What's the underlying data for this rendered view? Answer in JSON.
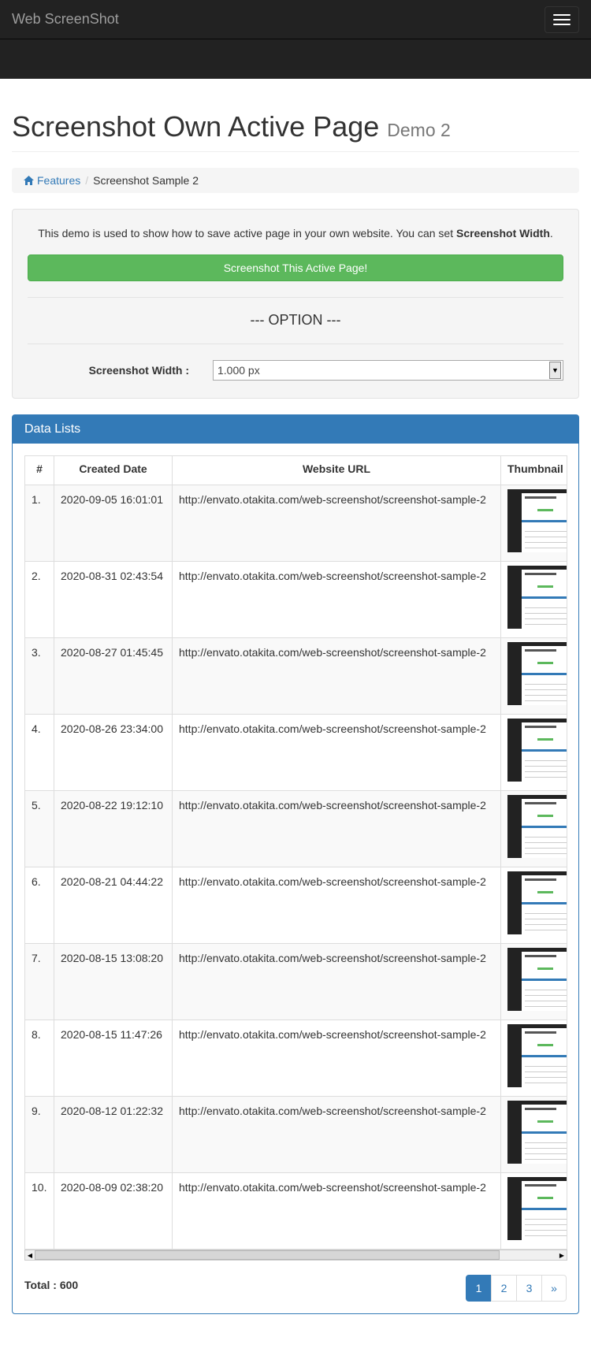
{
  "navbar": {
    "brand": "Web ScreenShot",
    "toggle_icon": "hamburger-menu-icon"
  },
  "header": {
    "title": "Screenshot Own Active Page",
    "subtitle": "Demo 2"
  },
  "breadcrumb": {
    "home_icon": "home-icon",
    "home_label": "Features",
    "current": "Screenshot Sample 2"
  },
  "intro": {
    "text": "This demo is used to show how to save active page in your own website. You can set",
    "bold": "Screenshot Width",
    "end": "."
  },
  "actions": {
    "screenshot_button": "Screenshot This Active Page!"
  },
  "options": {
    "title": "--- OPTION ---",
    "width_label": "Screenshot Width :",
    "width_value": "1.000 px"
  },
  "panel": {
    "title": "Data Lists",
    "columns": [
      "#",
      "Created Date",
      "Website URL",
      "Thumbnail"
    ],
    "rows": [
      {
        "num": "1.",
        "date": "2020-09-05 16:01:01",
        "url": "http://envato.otakita.com/web-screenshot/screenshot-sample-2"
      },
      {
        "num": "2.",
        "date": "2020-08-31 02:43:54",
        "url": "http://envato.otakita.com/web-screenshot/screenshot-sample-2"
      },
      {
        "num": "3.",
        "date": "2020-08-27 01:45:45",
        "url": "http://envato.otakita.com/web-screenshot/screenshot-sample-2"
      },
      {
        "num": "4.",
        "date": "2020-08-26 23:34:00",
        "url": "http://envato.otakita.com/web-screenshot/screenshot-sample-2"
      },
      {
        "num": "5.",
        "date": "2020-08-22 19:12:10",
        "url": "http://envato.otakita.com/web-screenshot/screenshot-sample-2"
      },
      {
        "num": "6.",
        "date": "2020-08-21 04:44:22",
        "url": "http://envato.otakita.com/web-screenshot/screenshot-sample-2"
      },
      {
        "num": "7.",
        "date": "2020-08-15 13:08:20",
        "url": "http://envato.otakita.com/web-screenshot/screenshot-sample-2"
      },
      {
        "num": "8.",
        "date": "2020-08-15 11:47:26",
        "url": "http://envato.otakita.com/web-screenshot/screenshot-sample-2"
      },
      {
        "num": "9.",
        "date": "2020-08-12 01:22:32",
        "url": "http://envato.otakita.com/web-screenshot/screenshot-sample-2"
      },
      {
        "num": "10.",
        "date": "2020-08-09 02:38:20",
        "url": "http://envato.otakita.com/web-screenshot/screenshot-sample-2"
      }
    ],
    "total_label": "Total : 600",
    "pages": [
      "1",
      "2",
      "3",
      "»"
    ],
    "active_page": "1"
  },
  "colors": {
    "navbar": "#222222",
    "primary": "#337ab7",
    "success": "#5cb85c"
  }
}
